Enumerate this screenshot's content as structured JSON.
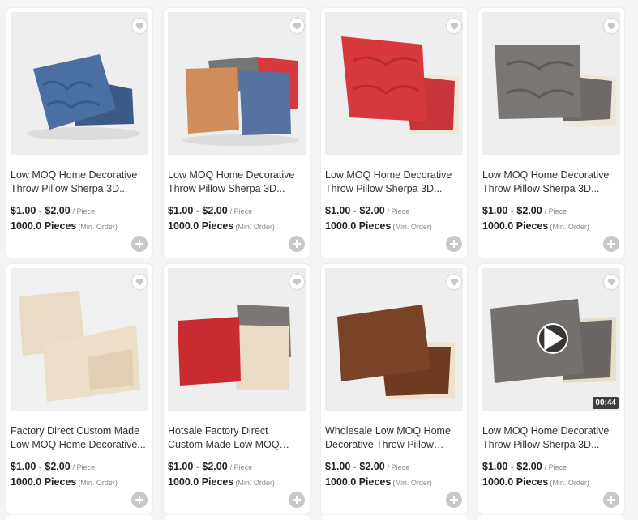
{
  "products": [
    {
      "title": "Low MOQ Home Decorative Throw Pillow Sherpa 3D...",
      "price": "$1.00 - $2.00",
      "unit": "/ Piece",
      "moq": "1000.0 Pieces",
      "moq_note": "(Min. Order)",
      "image": "blue-cable-pillows"
    },
    {
      "title": "Low MOQ Home Decorative Throw Pillow Sherpa 3D...",
      "price": "$1.00 - $2.00",
      "unit": "/ Piece",
      "moq": "1000.0 Pieces",
      "moq_note": "(Min. Order)",
      "image": "multicolor-pillows"
    },
    {
      "title": "Low MOQ Home Decorative Throw Pillow Sherpa 3D...",
      "price": "$1.00 - $2.00",
      "unit": "/ Piece",
      "moq": "1000.0 Pieces",
      "moq_note": "(Min. Order)",
      "image": "red-cable-pillows"
    },
    {
      "title": "Low MOQ Home Decorative Throw Pillow Sherpa 3D...",
      "price": "$1.00 - $2.00",
      "unit": "/ Piece",
      "moq": "1000.0 Pieces",
      "moq_note": "(Min. Order)",
      "image": "grey-cable-pillows"
    },
    {
      "title": "Factory Direct Custom Made Low MOQ Home Decorative...",
      "price": "$1.00 - $2.00",
      "unit": "/ Piece",
      "moq": "1000.0 Pieces",
      "moq_note": "(Min. Order)",
      "image": "beige-love-pillows"
    },
    {
      "title": "Hotsale Factory Direct Custom Made Low MOQ Home...",
      "price": "$1.00 - $2.00",
      "unit": "/ Piece",
      "moq": "1000.0 Pieces",
      "moq_note": "(Min. Order)",
      "image": "red-grey-love-pillows"
    },
    {
      "title": "Wholesale Low MOQ Home Decorative Throw Pillow Sher...",
      "price": "$1.00 - $2.00",
      "unit": "/ Piece",
      "moq": "1000.0 Pieces",
      "moq_note": "(Min. Order)",
      "image": "brown-love-pillows"
    },
    {
      "title": "Low MOQ Home Decorative Throw Pillow Sherpa 3D...",
      "price": "$1.00 - $2.00",
      "unit": "/ Piece",
      "moq": "1000.0 Pieces",
      "moq_note": "(Min. Order)",
      "image": "grey-love-pillows-video",
      "video_duration": "00:44"
    }
  ],
  "icons": {
    "favorite": "heart-icon",
    "add": "plus-icon",
    "video": "play-icon"
  },
  "colors": {
    "add_button": "#c8c8c8",
    "price": "#222222",
    "meta": "#888888"
  }
}
